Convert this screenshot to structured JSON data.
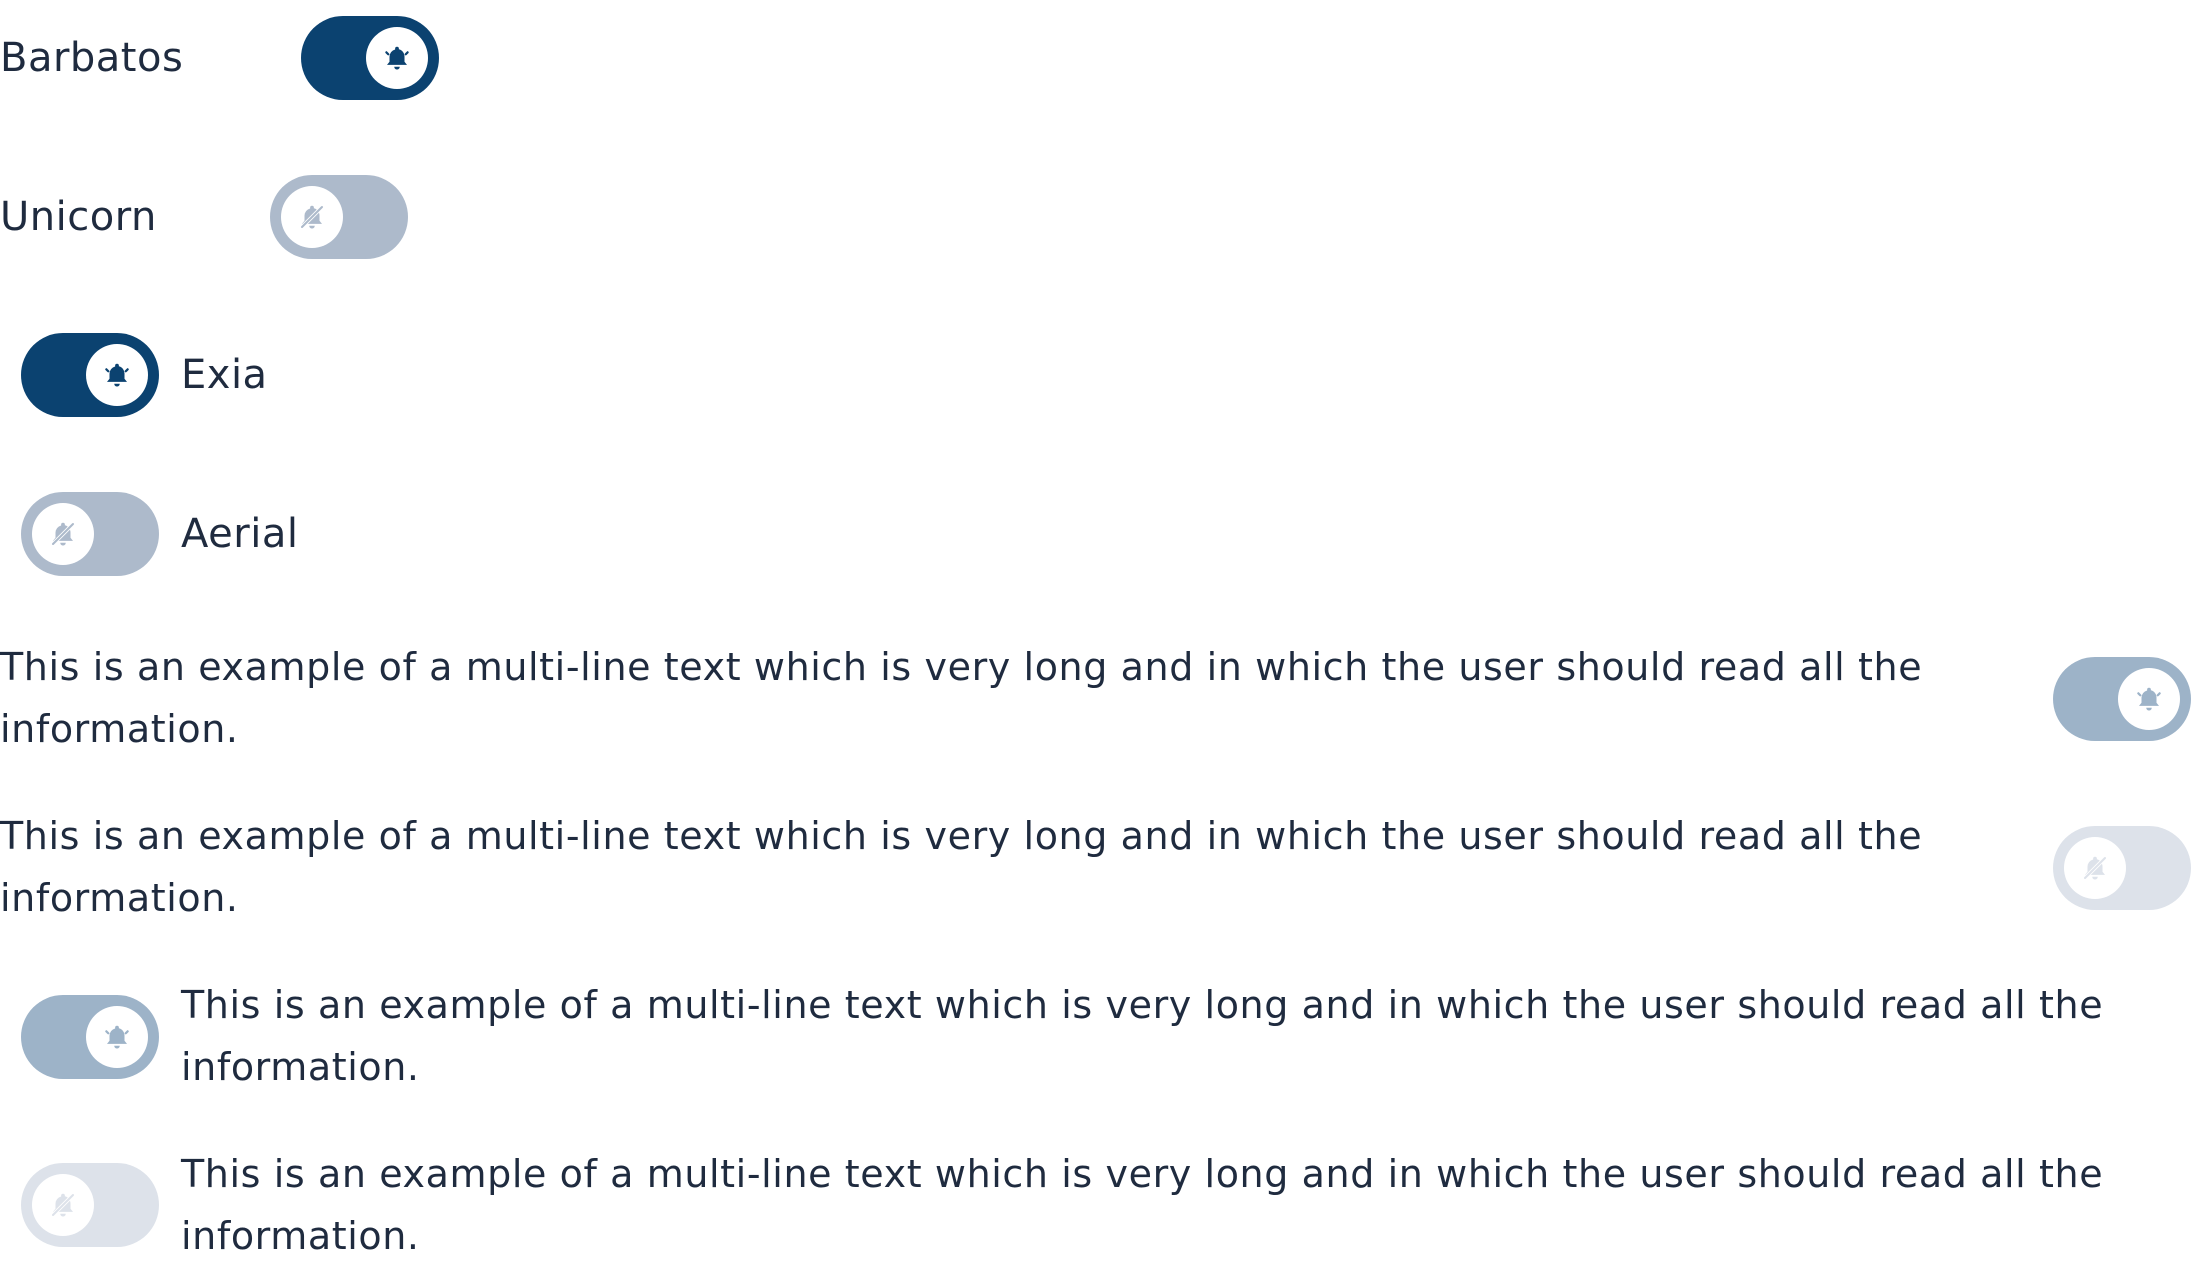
{
  "colors": {
    "on_enabled": "#0b4270",
    "off_enabled": "#adbacb",
    "on_disabled": "#9db3c8",
    "off_disabled": "#dde2ea",
    "text": "#1f2b3f"
  },
  "toggles": [
    {
      "label": "Barbatos",
      "state": "on",
      "disabled": false,
      "icon": "bell-icon"
    },
    {
      "label": "Unicorn",
      "state": "off",
      "disabled": false,
      "icon": "bell-off-icon"
    },
    {
      "label": "Exia",
      "state": "on",
      "disabled": false,
      "icon": "bell-icon"
    },
    {
      "label": "Aerial",
      "state": "off",
      "disabled": false,
      "icon": "bell-off-icon"
    },
    {
      "label": "This is an example of a multi-line text which is very long and in which the user should read all the information.",
      "state": "on",
      "disabled": true,
      "icon": "bell-icon"
    },
    {
      "label": "This is an example of a multi-line text which is very long and in which the user should read all the information.",
      "state": "off",
      "disabled": true,
      "icon": "bell-off-icon"
    },
    {
      "label": "This is an example of a multi-line text which is very long and in which the user should read all the information.",
      "state": "on",
      "disabled": true,
      "icon": "bell-icon"
    },
    {
      "label": "This is an example of a multi-line text which is very long and in which the user should read all the information.",
      "state": "off",
      "disabled": true,
      "icon": "bell-off-icon"
    }
  ]
}
